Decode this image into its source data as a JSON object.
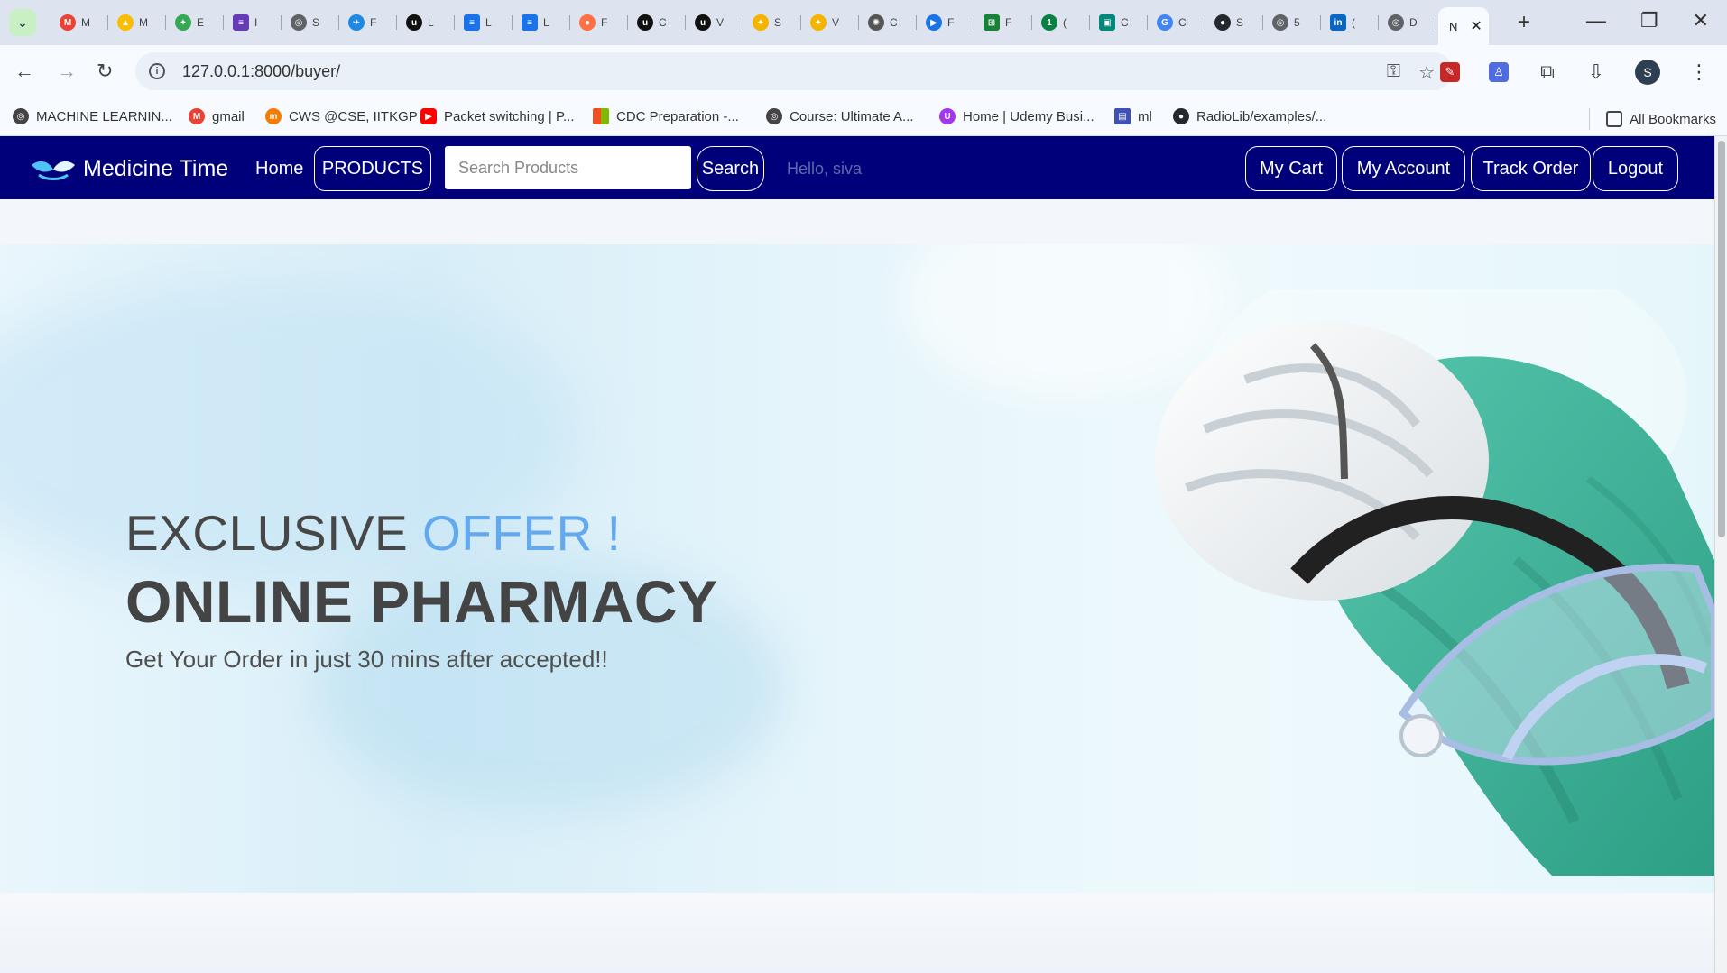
{
  "browser": {
    "tabs": [
      {
        "label": "M",
        "icon": "gmail-icon",
        "color": "#ea4335"
      },
      {
        "label": "M",
        "icon": "drive-icon",
        "color": "#fbbc04"
      },
      {
        "label": "E",
        "icon": "pinwheel-icon",
        "color": "#34a853"
      },
      {
        "label": "I",
        "icon": "list-icon",
        "color": "#673ab7"
      },
      {
        "label": "S",
        "icon": "globe-icon",
        "color": "#5f6368"
      },
      {
        "label": "F",
        "icon": "bird-icon",
        "color": "#1e88e5"
      },
      {
        "label": "L",
        "icon": "upwork-icon",
        "color": "#111111"
      },
      {
        "label": "L",
        "icon": "docs-icon",
        "color": "#1a73e8"
      },
      {
        "label": "L",
        "icon": "docs-icon",
        "color": "#1a73e8"
      },
      {
        "label": "F",
        "icon": "orange-circle-icon",
        "color": "#ff7043"
      },
      {
        "label": "C",
        "icon": "upwork-icon",
        "color": "#111111"
      },
      {
        "label": "V",
        "icon": "upwork-icon",
        "color": "#111111"
      },
      {
        "label": "S",
        "icon": "colorful-spark-icon",
        "color": "#f4b400"
      },
      {
        "label": "V",
        "icon": "colorful-spark-icon",
        "color": "#f4b400"
      },
      {
        "label": "C",
        "icon": "chatgpt-icon",
        "color": "#555555"
      },
      {
        "label": "F",
        "icon": "play-icon",
        "color": "#1a73e8"
      },
      {
        "label": "F",
        "icon": "sheet-icon",
        "color": "#188038"
      },
      {
        "label": "(",
        "icon": "green-one-icon",
        "color": "#0b8043"
      },
      {
        "label": "C",
        "icon": "meet-icon",
        "color": "#00897b"
      },
      {
        "label": "C",
        "icon": "google-icon",
        "color": "#4285f4"
      },
      {
        "label": "S",
        "icon": "github-icon",
        "color": "#24292f"
      },
      {
        "label": "5",
        "icon": "globe-icon",
        "color": "#5f6368"
      },
      {
        "label": "(",
        "icon": "linkedin-icon",
        "color": "#0a66c2"
      },
      {
        "label": "D",
        "icon": "globe-icon",
        "color": "#5f6368"
      }
    ],
    "active_tab": "N",
    "url": "127.0.0.1:8000/buyer/",
    "bookmarks": [
      {
        "label": "MACHINE LEARNIN...",
        "icon": "globe-icon",
        "color": "#444444"
      },
      {
        "label": "gmail",
        "icon": "gmail-icon",
        "color": "#ea4335"
      },
      {
        "label": "CWS @CSE, IITKGP",
        "icon": "cws-icon",
        "color": "#f57c00"
      },
      {
        "label": "Packet switching | P...",
        "icon": "youtube-icon",
        "color": "#ff0000"
      },
      {
        "label": "CDC Preparation -...",
        "icon": "microsoft-icon",
        "color": "#f25022"
      },
      {
        "label": "Course: Ultimate A...",
        "icon": "globe-icon",
        "color": "#444444"
      },
      {
        "label": "Home | Udemy Busi...",
        "icon": "udemy-icon",
        "color": "#a435f0"
      },
      {
        "label": "ml",
        "icon": "layout-icon",
        "color": "#3f51b5"
      },
      {
        "label": "RadioLib/examples/...",
        "icon": "github-icon",
        "color": "#24292f"
      }
    ],
    "all_bookmarks": "All Bookmarks",
    "profile_initial": "S"
  },
  "site": {
    "brand": "Medicine Time",
    "home": "Home",
    "products": "PRODUCTS",
    "search_placeholder": "Search Products",
    "search_button": "Search",
    "greeting": "Hello, siva",
    "nav": [
      "My Cart",
      "My Account",
      "Track Order",
      "Logout"
    ]
  },
  "hero": {
    "headline_prefix": "EXCLUSIVE ",
    "headline_accent": "OFFER !",
    "title": "ONLINE PHARMACY",
    "subtitle": "Get Your Order in just 30 mins after accepted!!"
  },
  "colors": {
    "navbar": "#00007a",
    "accent": "#63a9ed",
    "gloves": "#37b99c"
  }
}
